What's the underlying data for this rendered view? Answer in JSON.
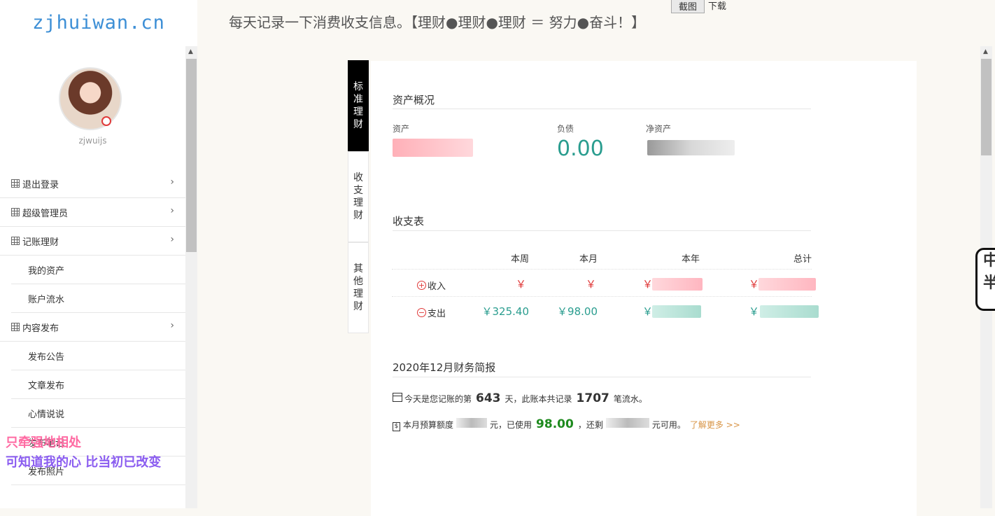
{
  "brand": "zjhuiwan.cn",
  "header": {
    "slogan": "每天记录一下消费收支信息。【理财●理财●理财 ＝ 努力●奋斗！】",
    "screenshot_button": "截图",
    "download_link": "下载"
  },
  "user": {
    "name": "zjwuijs"
  },
  "sidebar": {
    "items": [
      {
        "label": "退出登录"
      },
      {
        "label": "超级管理员"
      },
      {
        "label": "记账理财"
      },
      {
        "label": "我的资产"
      },
      {
        "label": "账户流水"
      },
      {
        "label": "内容发布"
      },
      {
        "label": "发布公告"
      },
      {
        "label": "文章发布"
      },
      {
        "label": "心情说说"
      },
      {
        "label": "发布笔记"
      },
      {
        "label": "发布照片"
      }
    ]
  },
  "lyrics": [
    "只牵强地相处",
    "可知道我的心 比当初已改变"
  ],
  "tabs": [
    {
      "label": "标准理财"
    },
    {
      "label": "收支理财"
    },
    {
      "label": "其他理财"
    }
  ],
  "assets": {
    "title": "资产概况",
    "asset_label": "资产",
    "debt_label": "负债",
    "debt_value": "0.00",
    "net_label": "净资产"
  },
  "ledger": {
    "title": "收支表",
    "columns": [
      "本周",
      "本月",
      "本年",
      "总计"
    ],
    "income_label": "收入",
    "expense_label": "支出",
    "income": {
      "week": "￥",
      "month": "￥",
      "year": "￥",
      "total": "￥"
    },
    "expense": {
      "week": "￥325.40",
      "month": "￥98.00",
      "year": "￥",
      "total": "￥"
    }
  },
  "report": {
    "title": "2020年12月财务简报",
    "line1_a": "今天是您记账的第",
    "days": "643",
    "line1_b": "天，此账本共记录",
    "records": "1707",
    "line1_c": "笔流水。",
    "line2_a": "本月预算额度",
    "line2_b": "元，已使用",
    "used": "98.00",
    "line2_c": "，还剩",
    "line2_d": "元可用。",
    "more_link": "了解更多 >>"
  },
  "float_badge": [
    "中",
    "半"
  ],
  "colors": {
    "accent_green": "#2a9d8f",
    "accent_red": "#e03a3a",
    "brand_blue": "#3d8fd6"
  }
}
